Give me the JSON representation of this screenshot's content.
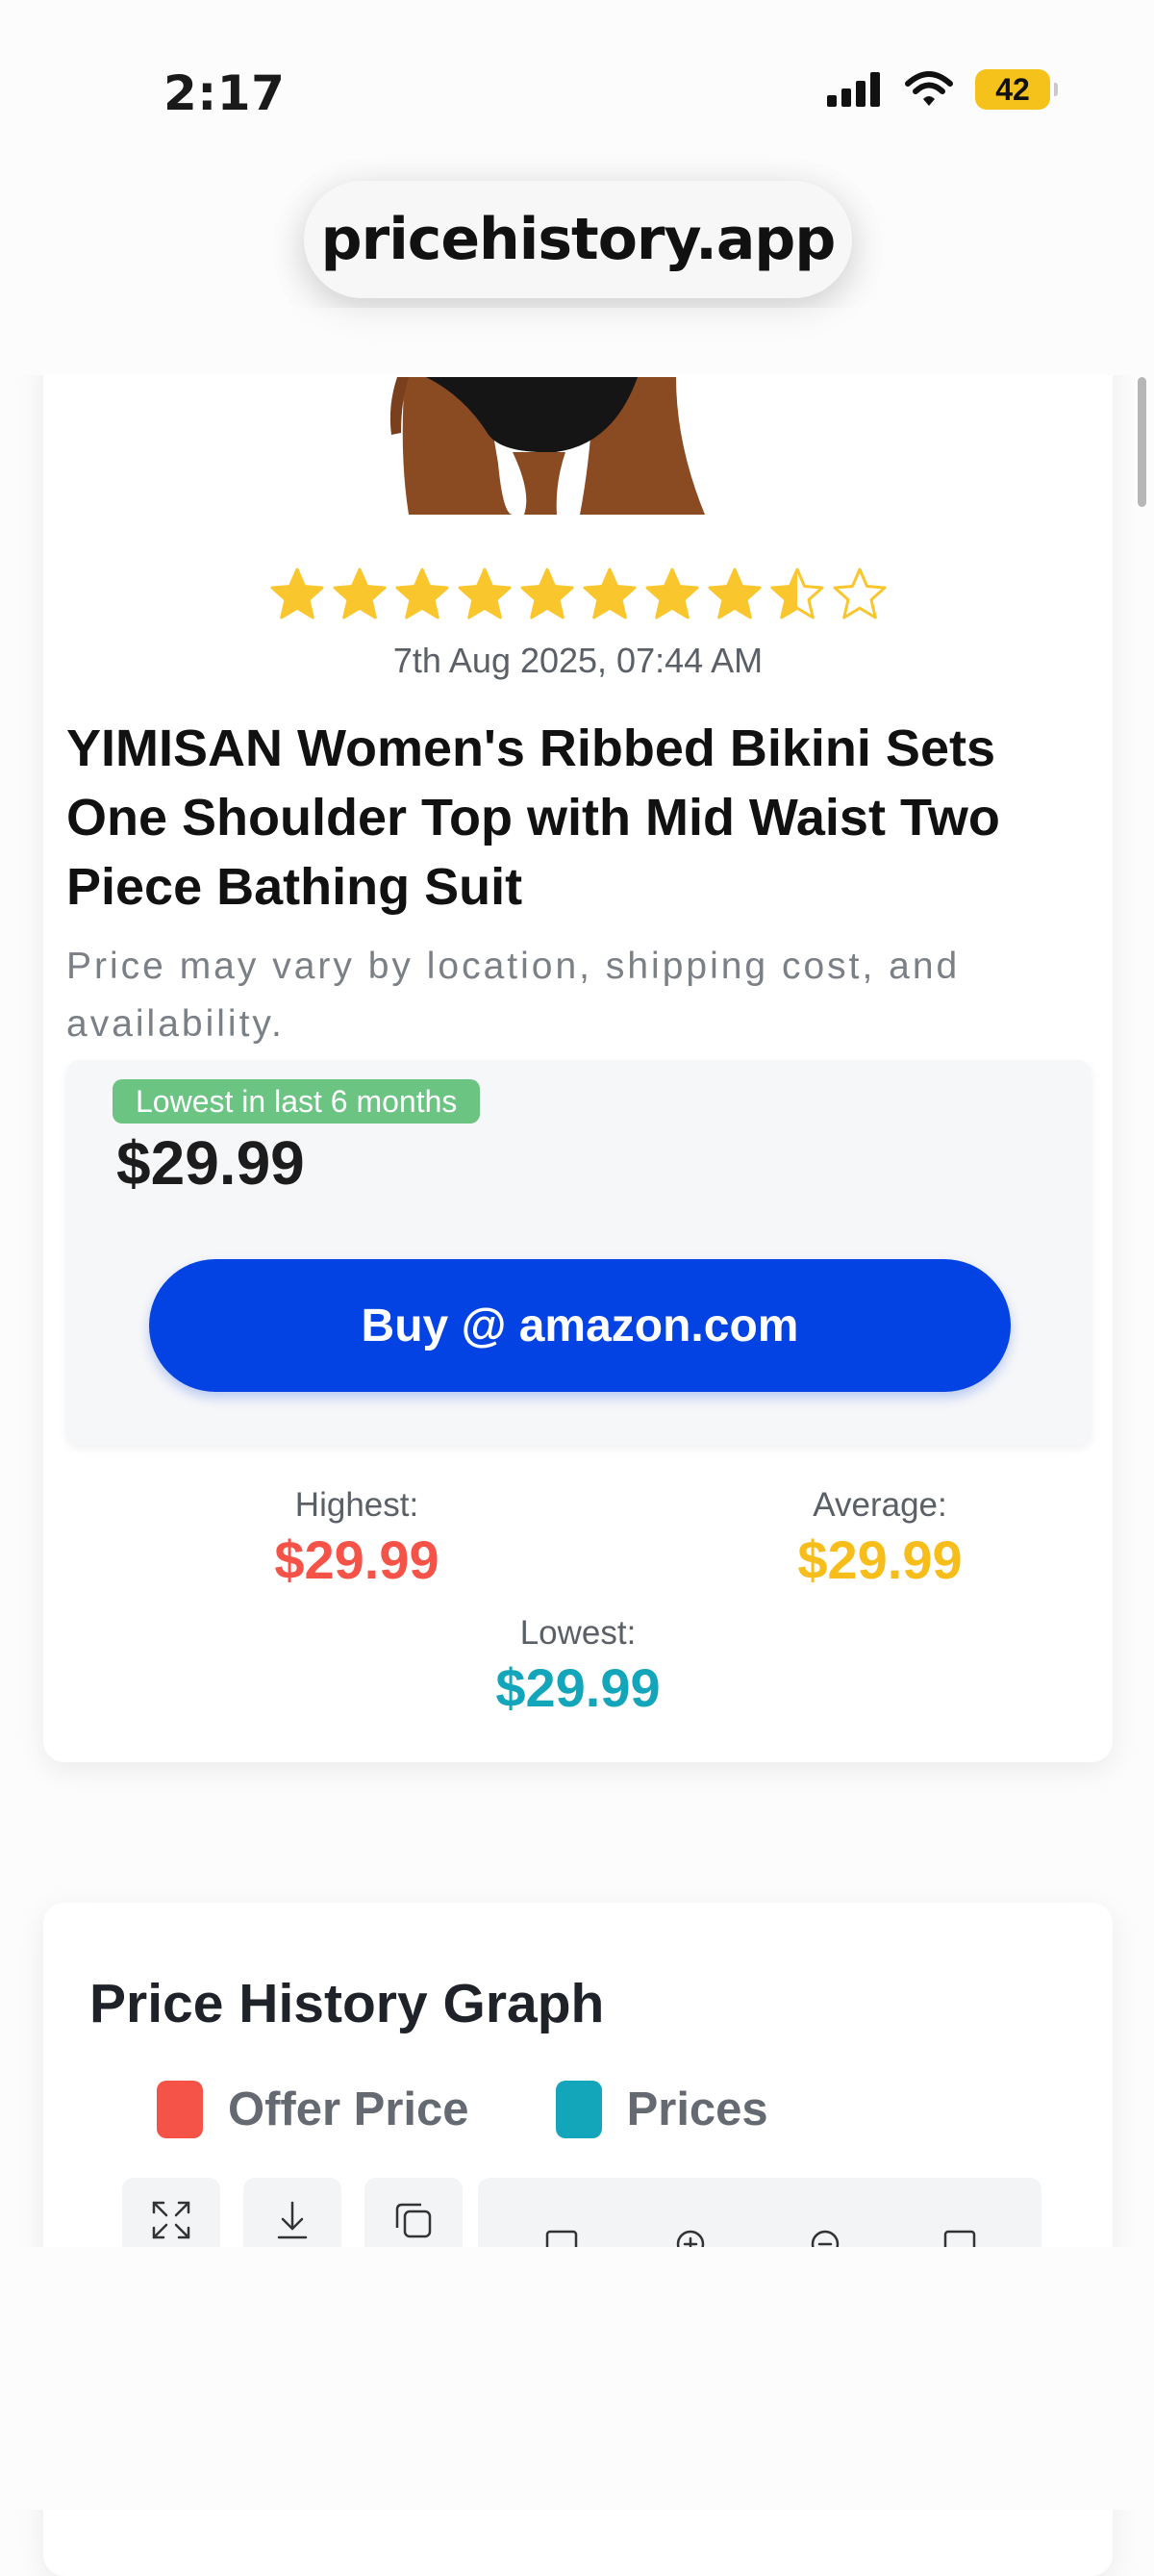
{
  "status_bar": {
    "time": "2:17",
    "battery": "42"
  },
  "browser": {
    "url": "pricehistory.app"
  },
  "product": {
    "rating": 4.5,
    "max_rating": 10,
    "filled_stars": 8.5,
    "date": "7th Aug 2025, 07:44 AM",
    "title": "YIMISAN Women's Ribbed Bikini Sets One Shoulder Top with Mid Waist Two Piece Bathing Suit",
    "disclaimer": "Price may vary by location, shipping cost, and availability.",
    "badge": "Lowest in last 6 months",
    "current_price": "$29.99",
    "buy_label": "Buy @ amazon.com"
  },
  "stats": {
    "highest_label": "Highest:",
    "highest_value": "$29.99",
    "average_label": "Average:",
    "average_value": "$29.99",
    "lowest_label": "Lowest:",
    "lowest_value": "$29.99"
  },
  "graph": {
    "title": "Price History Graph",
    "legend": [
      {
        "label": "Offer Price",
        "color": "#f55348"
      },
      {
        "label": "Prices",
        "color": "#13a5b9"
      }
    ],
    "toolbar_icons": [
      "expand-icon",
      "download-icon",
      "copy-icon",
      "pan-left-icon",
      "zoom-in-icon",
      "zoom-out-icon",
      "pan-right-icon"
    ]
  },
  "colors": {
    "accent": "#0443e3",
    "highest": "#f55348",
    "average": "#f7be1b",
    "lowest": "#13a5b9",
    "badge": "#6cc483",
    "star": "#f9c62d"
  }
}
